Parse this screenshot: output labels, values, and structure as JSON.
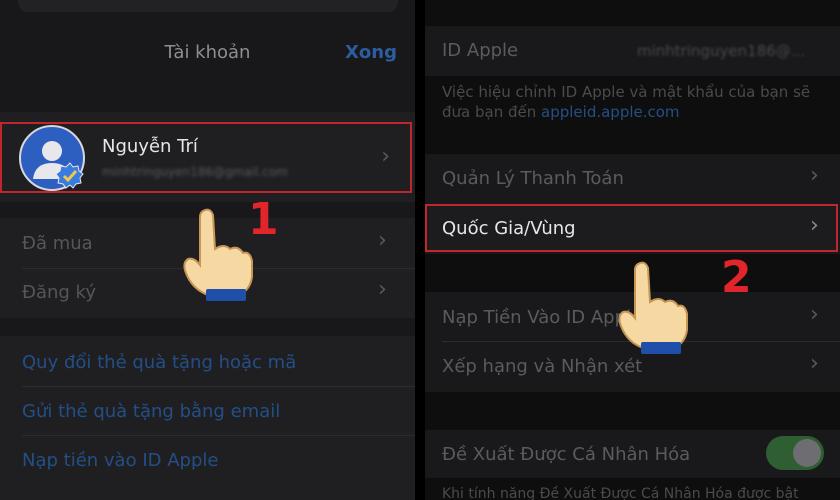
{
  "left": {
    "nav_title": "Tài khoản",
    "done_label": "Xong",
    "profile_name": "Nguyễn Trí",
    "profile_email": "minhtringuyen186@gmail.com",
    "rows": [
      "Đã mua",
      "Đăng ký"
    ],
    "links": [
      "Quy đổi thẻ quà tặng hoặc mã",
      "Gửi thẻ quà tặng bằng email",
      "Nạp tiền vào ID Apple"
    ],
    "step_number": "1"
  },
  "right": {
    "apple_id_label": "ID Apple",
    "apple_id_value": "minhtringuyen186@...",
    "apple_id_note": "Việc hiệu chỉnh ID Apple và mật khẩu của bạn sẽ đưa bạn đến",
    "apple_id_link": "appleid.apple.com",
    "rows": [
      "Quản Lý Thanh Toán",
      "Quốc Gia/Vùng",
      "Nạp Tiền Vào ID Apple",
      "Xếp hạng và Nhận xét"
    ],
    "personalize_label": "Đề Xuất Được Cá Nhân Hóa",
    "personalize_note": "Khi tính năng Đề Xuất Được Cá Nhân Hóa được bật",
    "step_number": "2"
  },
  "colors": {
    "highlight": "#c0262c",
    "step_number": "#e2242b",
    "link": "#234f87"
  },
  "icons": [
    "chevron-right-icon",
    "pointing-hand-icon",
    "verified-badge-icon",
    "user-avatar-icon"
  ]
}
